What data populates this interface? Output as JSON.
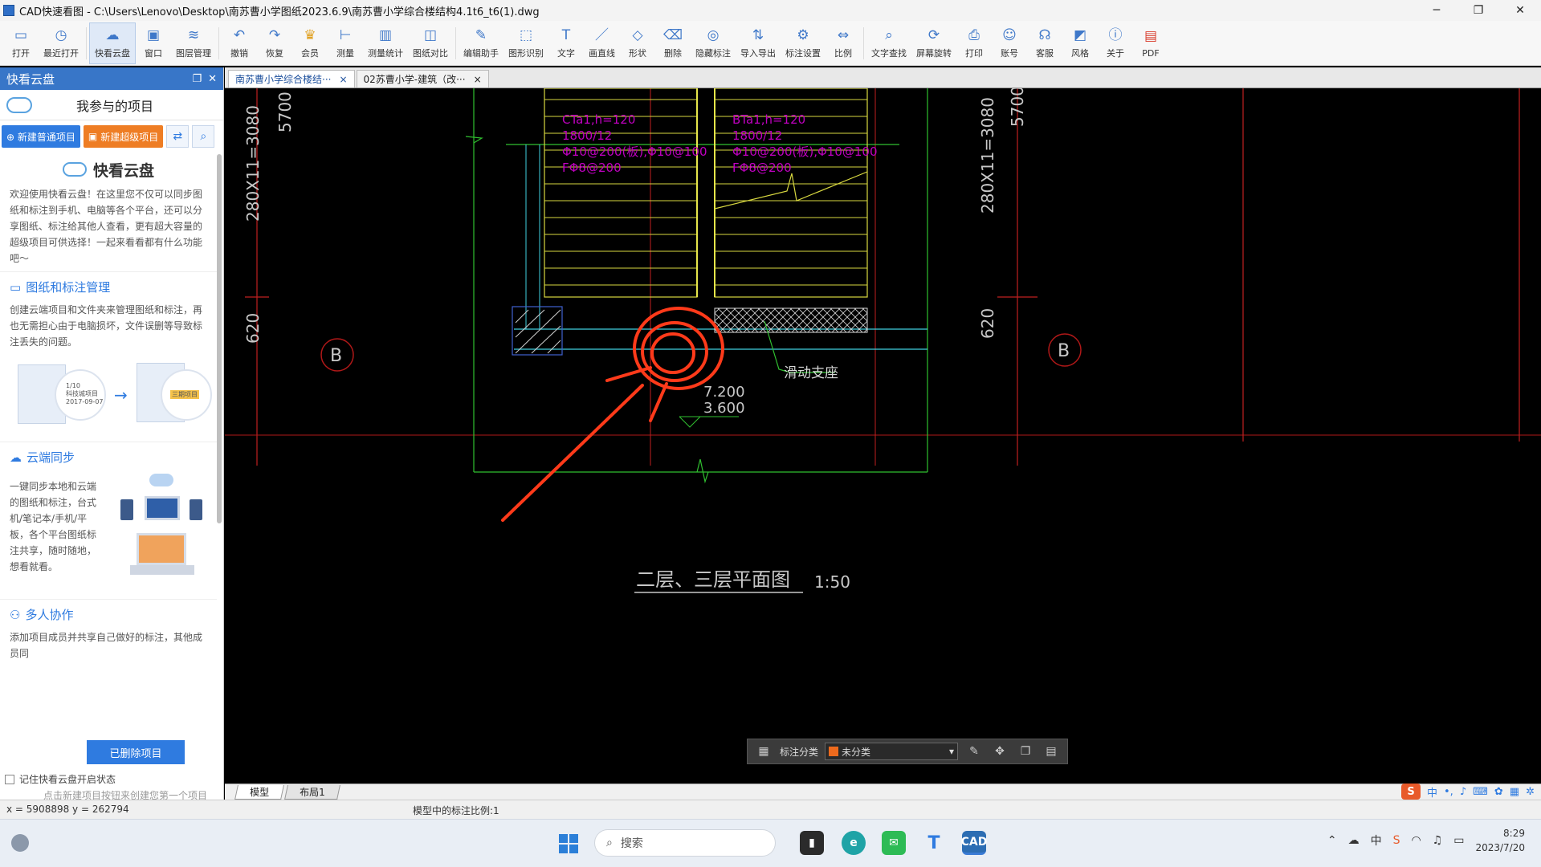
{
  "window": {
    "title": "CAD快速看图 - C:\\Users\\Lenovo\\Desktop\\南苏曹小学图纸2023.6.9\\南苏曹小学综合楼结构4.1t6_t6(1).dwg",
    "min": "─",
    "max": "❐",
    "close": "✕"
  },
  "toolbar": [
    {
      "label": "打开",
      "icon": "open-folder-icon"
    },
    {
      "label": "最近打开",
      "icon": "recent-clock-icon"
    },
    {
      "label": "快看云盘",
      "icon": "cloud-icon"
    },
    {
      "label": "窗口",
      "icon": "window-icon"
    },
    {
      "label": "图层管理",
      "icon": "layers-icon"
    },
    {
      "label": "撤销",
      "icon": "undo-icon"
    },
    {
      "label": "恢复",
      "icon": "redo-icon"
    },
    {
      "label": "会员",
      "icon": "vip-icon"
    },
    {
      "label": "测量",
      "icon": "measure-icon"
    },
    {
      "label": "测量统计",
      "icon": "measure-stats-icon"
    },
    {
      "label": "图纸对比",
      "icon": "compare-icon"
    },
    {
      "label": "编辑助手",
      "icon": "edit-assistant-icon"
    },
    {
      "label": "图形识别",
      "icon": "shape-recognition-icon"
    },
    {
      "label": "文字",
      "icon": "text-icon"
    },
    {
      "label": "画直线",
      "icon": "line-icon"
    },
    {
      "label": "形状",
      "icon": "shape-icon"
    },
    {
      "label": "删除",
      "icon": "eraser-icon"
    },
    {
      "label": "隐藏标注",
      "icon": "hide-annotation-icon"
    },
    {
      "label": "导入导出",
      "icon": "import-export-icon"
    },
    {
      "label": "标注设置",
      "icon": "annotation-settings-icon"
    },
    {
      "label": "比例",
      "icon": "scale-icon"
    },
    {
      "label": "文字查找",
      "icon": "text-search-icon"
    },
    {
      "label": "屏幕旋转",
      "icon": "rotate-screen-icon"
    },
    {
      "label": "打印",
      "icon": "print-icon"
    },
    {
      "label": "账号",
      "icon": "account-icon"
    },
    {
      "label": "客服",
      "icon": "headset-icon"
    },
    {
      "label": "风格",
      "icon": "style-icon"
    },
    {
      "label": "关于",
      "icon": "info-icon"
    },
    {
      "label": "PDF",
      "icon": "pdf-icon"
    }
  ],
  "panel": {
    "header": "快看云盘",
    "project_title": "我参与的项目",
    "new_normal": "⊕ 新建普通项目",
    "new_super": "新建超级项目",
    "brand": "快看云盘",
    "intro": "欢迎使用快看云盘！在这里您不仅可以同步图纸和标注到手机、电脑等各个平台，还可以分享图纸、标注给其他人查看，更有超大容量的超级项目可供选择！一起来看看都有什么功能吧～",
    "sections": [
      {
        "title": "图纸和标注管理",
        "text": "创建云端项目和文件夹来管理图纸和标注，再也无需担心由于电脑损坏，文件误删等导致标注丢失的问题。"
      },
      {
        "title": "云端同步",
        "text": "一键同步本地和云端的图纸和标注，台式机/笔记本/手机/平板，各个平台图纸标注共享，随时随地，想看就看。"
      },
      {
        "title": "多人协作",
        "text": "添加项目成员并共享自己做好的标注，其他成员同"
      }
    ],
    "illus_labels": [
      "科技城项目",
      "1/10",
      "2017-09-07",
      "三期项目"
    ],
    "deleted_btn": "已删除项目",
    "remember": "记住快看云盘开启状态",
    "hint": "点击新建项目按钮来创建您第一个项目"
  },
  "tabs": [
    {
      "label": "南苏曹小学综合楼结···",
      "close": "×"
    },
    {
      "label": "02苏曹小学-建筑（改···",
      "close": "×"
    }
  ],
  "drawing": {
    "dim_left_vertical": "280X11=3080",
    "dim_left_top": "5700",
    "dim_left_bottom": "620",
    "dim_right_vertical": "280X11=3080",
    "dim_right_top": "5700",
    "dim_right_bottom": "620",
    "axis_label": "B",
    "stair_left_note": [
      "CTa1,h=120",
      "1800/12",
      "Φ10@200(板),Φ10@100",
      "FΦ8@200"
    ],
    "stair_right_note": [
      "BTa1,h=120",
      "1800/12",
      "Φ10@200(板),Φ10@100",
      "FΦ8@200"
    ],
    "support_label": "滑动支座",
    "elev_top": "7.200",
    "elev_bottom": "3.600",
    "plan_title": "二层、三层平面图",
    "plan_scale": "1:50"
  },
  "annotation_bar": {
    "category_label": "标注分类",
    "category_value": "未分类",
    "swatch_color": "#ee6a1d"
  },
  "layout_tabs": [
    "模型",
    "布局1"
  ],
  "ime": {
    "logo": "S",
    "mode": "中"
  },
  "status": {
    "coords": "x = 5908898  y = 262794",
    "scale": "模型中的标注比例:1"
  },
  "taskbar": {
    "search": "搜索",
    "time": "8:29",
    "date": "2023/7/20",
    "lang": "中"
  },
  "colors": {
    "accent": "#2f7be0",
    "orange": "#ee7d24",
    "markup_red": "#ff3a1a",
    "cad_green": "#3bd13b",
    "cad_magenta": "#c000c0",
    "cad_yellow": "#e6e64a",
    "cad_red": "#d02020"
  }
}
